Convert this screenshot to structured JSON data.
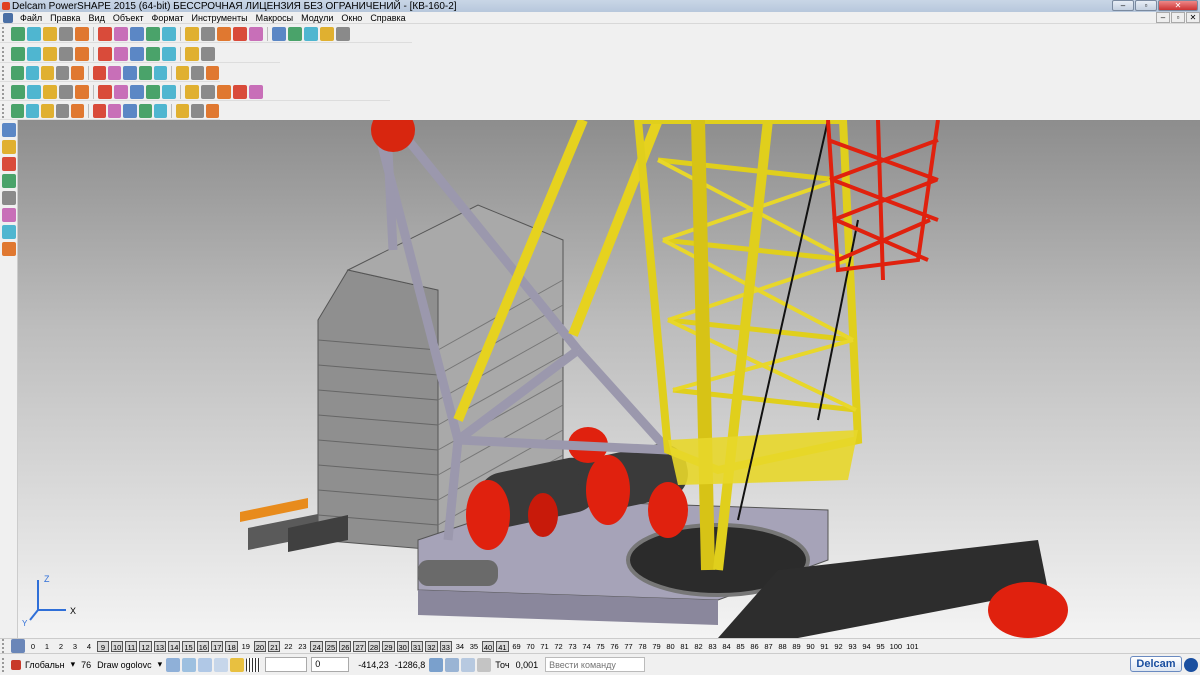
{
  "window": {
    "title": "Delcam PowerSHAPE 2015 (64-bit) БЕССРОЧНАЯ ЛИЦЕНЗИЯ БЕЗ ОГРАНИЧЕНИЙ - [КВ-160-2]",
    "minimize": "–",
    "maximize": "▫",
    "close": "✕"
  },
  "menu": [
    "Файл",
    "Правка",
    "Вид",
    "Объект",
    "Формат",
    "Инструменты",
    "Макросы",
    "Модули",
    "Окно",
    "Справка"
  ],
  "mdi": {
    "minimize": "–",
    "restore": "▫",
    "close": "✕"
  },
  "toolbars": {
    "row1_icons": [
      "new-icon",
      "open-icon",
      "save-icon",
      "print-icon",
      "cut-icon",
      "copy-icon",
      "paste-icon",
      "delete-icon",
      "undo-icon",
      "redo-icon",
      "select-icon",
      "view-icon",
      "rotate-icon",
      "circle-icon",
      "line-icon",
      "lasso-icon",
      "measure-icon",
      "box-icon",
      "model-icon",
      "wand-icon"
    ],
    "row2_icons": [
      "wireframe-icon",
      "shaded-icon",
      "box-view-icon",
      "isometric-icon",
      "zoom-in-icon",
      "zoom-out-icon",
      "zoom-window-icon",
      "zoom-fit-icon",
      "globe-icon",
      "sphere-icon",
      "light-icon",
      "hand-icon"
    ],
    "row3_icons": [
      "layer-icon",
      "doc-icon",
      "block-icon",
      "colour-icon",
      "surface-icon",
      "material-icon",
      "render-icon",
      "flag-icon",
      "component-icon",
      "assembly-icon",
      "info-icon",
      "hierarchy-icon",
      "star-icon"
    ],
    "row4_icons": [
      "solid-icon",
      "feature-icon",
      "extrude-icon",
      "revolve-icon",
      "boolean-icon",
      "fillet-icon",
      "chamfer-icon",
      "shell-icon",
      "cut-icon",
      "draft-icon",
      "split-icon",
      "pattern-icon",
      "mirror-icon",
      "history-icon",
      "check-icon"
    ],
    "row5_icons": [
      "workplane-icon",
      "arc-icon",
      "axis-icon",
      "solid-box-icon",
      "cylinder-icon",
      "cone-icon",
      "torus-icon",
      "sphere-solid-icon",
      "wedge-icon",
      "mesh-icon",
      "dimension-icon",
      "colour-solid-icon",
      "symbol-icon"
    ]
  },
  "left_tools": [
    "pointer-icon",
    "select-window-icon",
    "axis-x-icon",
    "axis-y-icon",
    "sphere-small-icon",
    "plane-icon",
    "move-icon",
    "snap-icon"
  ],
  "axes": {
    "x": "X",
    "y": "Y",
    "z": "Z"
  },
  "levels": [
    "0",
    "1",
    "2",
    "3",
    "4",
    "9",
    "10",
    "11",
    "12",
    "13",
    "14",
    "15",
    "16",
    "17",
    "18",
    "19",
    "20",
    "21",
    "22",
    "23",
    "24",
    "25",
    "26",
    "27",
    "28",
    "29",
    "30",
    "31",
    "32",
    "33",
    "34",
    "35",
    "40",
    "41",
    "69",
    "70",
    "71",
    "72",
    "73",
    "74",
    "75",
    "76",
    "77",
    "78",
    "79",
    "80",
    "81",
    "82",
    "83",
    "84",
    "85",
    "86",
    "87",
    "88",
    "89",
    "90",
    "91",
    "92",
    "93",
    "94",
    "95",
    "100",
    "101"
  ],
  "levels_on": [
    "9",
    "10",
    "11",
    "12",
    "13",
    "14",
    "15",
    "16",
    "17",
    "18",
    "20",
    "21",
    "24",
    "25",
    "26",
    "27",
    "28",
    "29",
    "30",
    "31",
    "32",
    "33",
    "40",
    "41"
  ],
  "status": {
    "workplane": "Глобальн",
    "level_num": "76",
    "level_name": "Draw ogolovc",
    "field_zero": "0",
    "x": "-414,23",
    "y": "-1286,8",
    "precision_label": "Точ",
    "precision": "0,001",
    "command_placeholder": "Ввести команду"
  },
  "brand": "Delcam"
}
